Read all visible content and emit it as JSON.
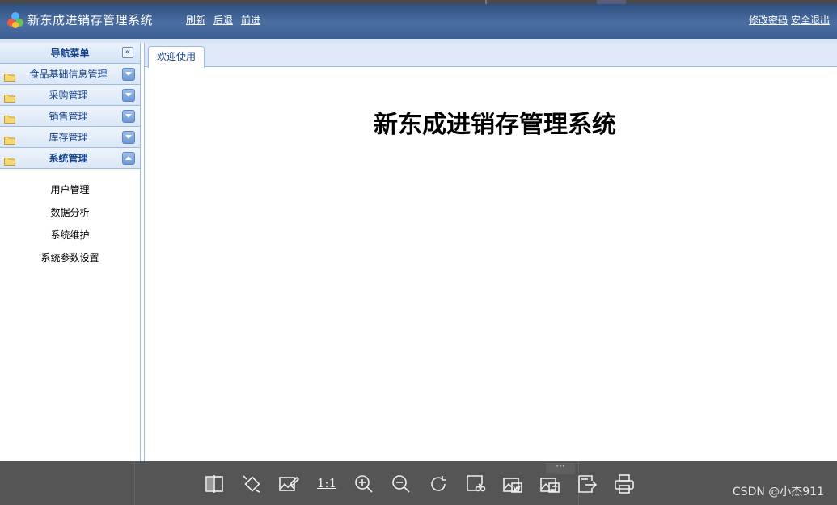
{
  "header": {
    "title": "新东成进销存管理系统",
    "nav": {
      "refresh": "刷新",
      "back": "后退",
      "forward": "前进"
    },
    "right": {
      "change_password": "修改密码",
      "logout": "安全退出"
    }
  },
  "sidebar": {
    "title": "导航菜单",
    "collapse_icon": "double-chevron-left-icon",
    "items": [
      {
        "label": "食品基础信息管理",
        "expanded": false
      },
      {
        "label": "采购管理",
        "expanded": false
      },
      {
        "label": "销售管理",
        "expanded": false
      },
      {
        "label": "库存管理",
        "expanded": false
      },
      {
        "label": "系统管理",
        "expanded": true
      }
    ],
    "submenu": [
      "用户管理",
      "数据分析",
      "系统维护",
      "系统参数设置"
    ]
  },
  "main": {
    "tabs": [
      {
        "label": "欢迎使用"
      }
    ],
    "welcome_heading": "新东成进销存管理系统"
  },
  "viewer_toolbar": {
    "ratio_label": "1:1",
    "watermark": "CSDN @小杰911",
    "more": "···"
  },
  "colors": {
    "header": "#3b5f92",
    "accent": "#15428b",
    "toolbar": "#555555"
  }
}
